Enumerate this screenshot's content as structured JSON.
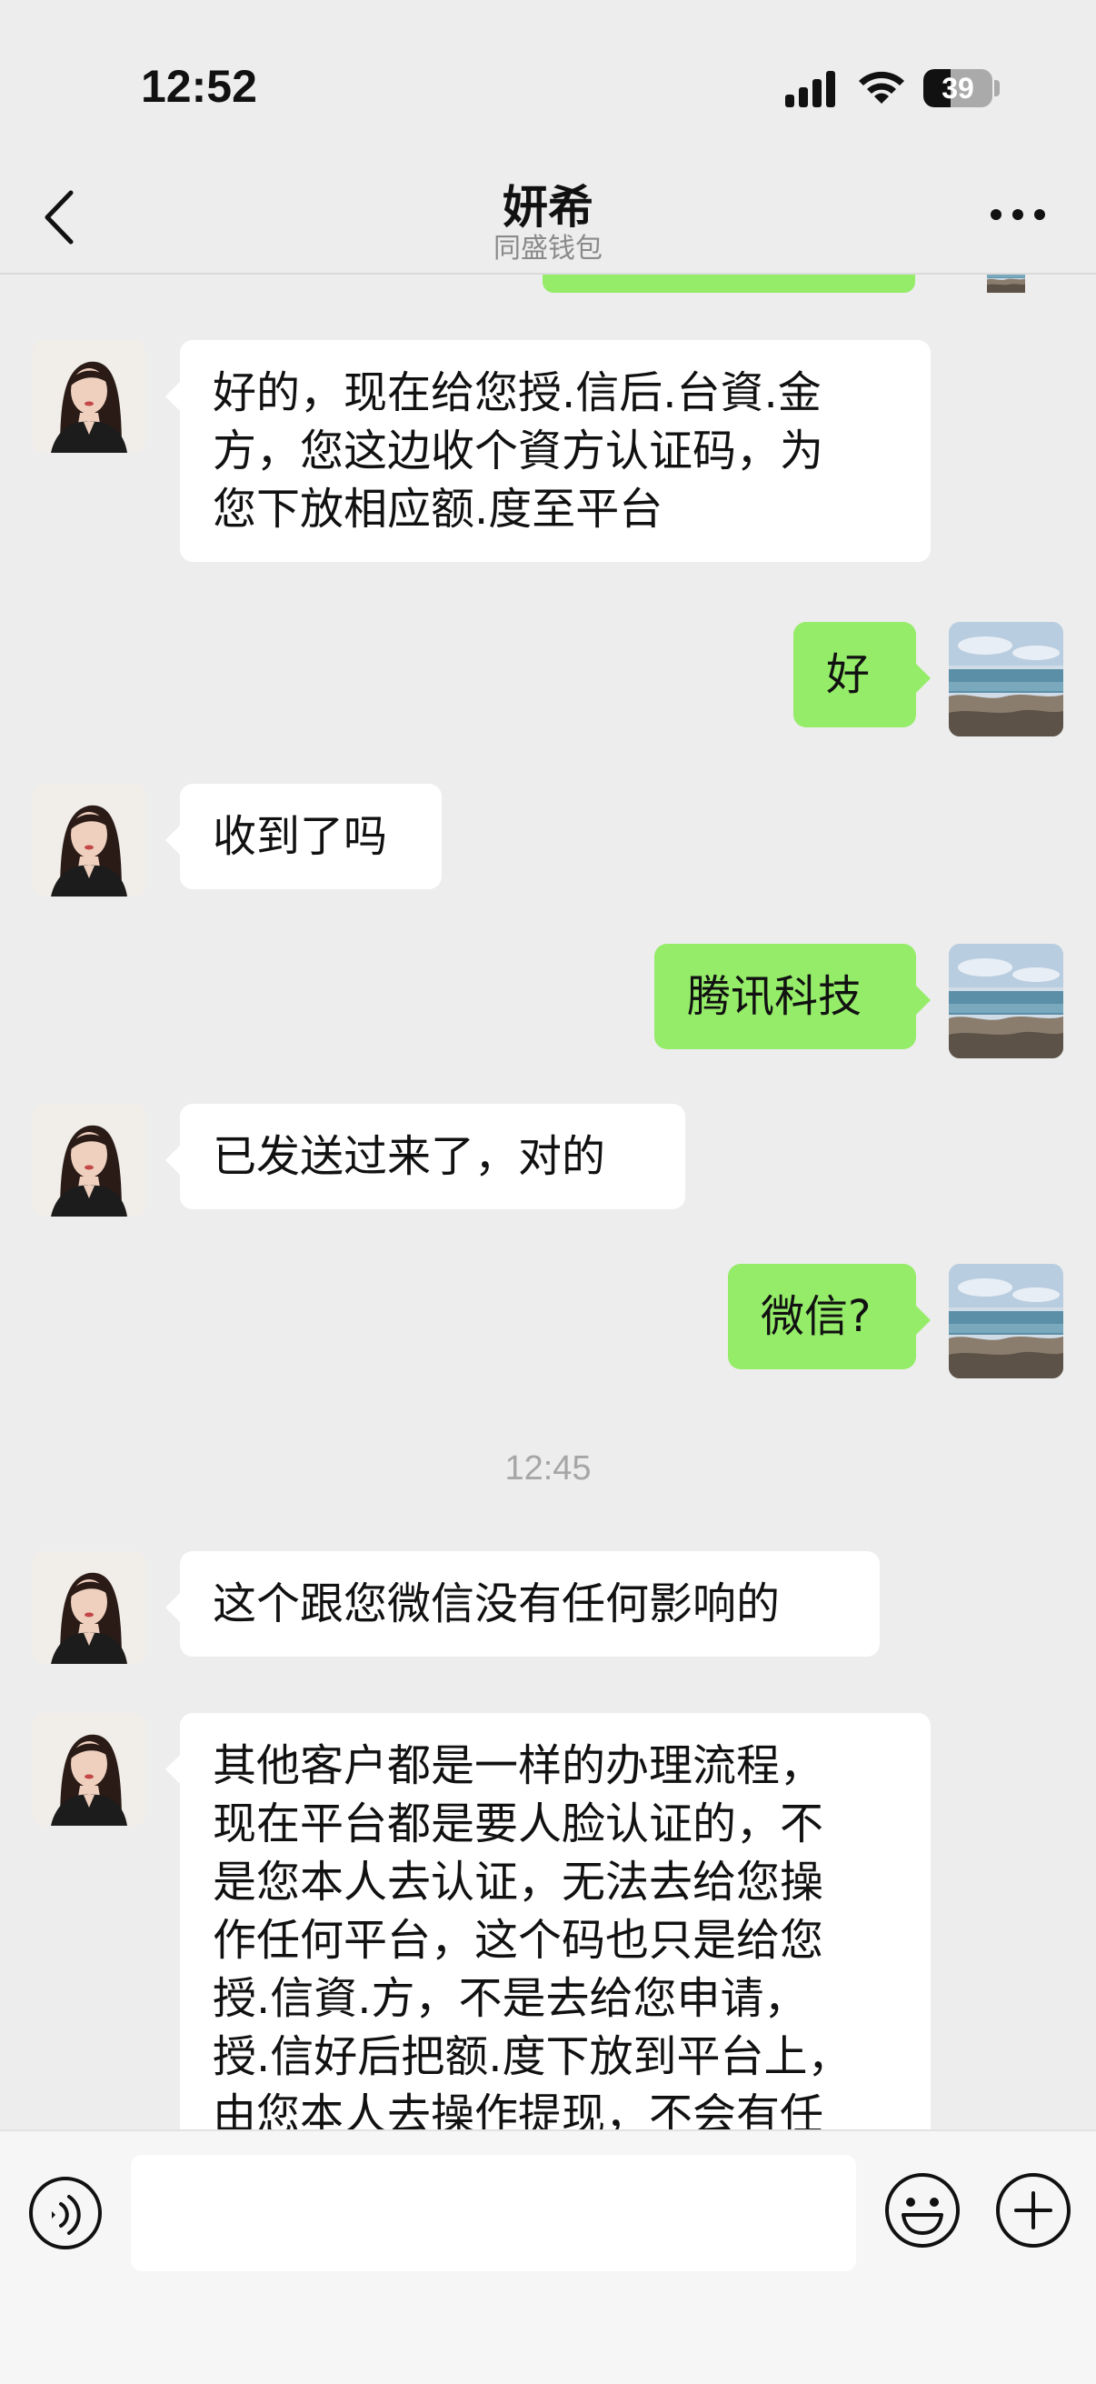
{
  "status_bar": {
    "time": "12:52",
    "battery": "39",
    "battery_level_percent": 39
  },
  "nav": {
    "title": "妍希",
    "subtitle": "同盛钱包",
    "back_icon": "chevron-left-icon",
    "more_icon": "more-dots-icon"
  },
  "messages": [
    {
      "side": "in",
      "text": "好的，现在给您授.信后.台資.金\n方，您这边收个資方认证码，为\n您下放相应额.度至平台"
    },
    {
      "side": "out",
      "text": "好"
    },
    {
      "side": "in",
      "text": "收到了吗"
    },
    {
      "side": "out",
      "text": "腾讯科技"
    },
    {
      "side": "in",
      "text": "已发送过来了，对的"
    },
    {
      "side": "out",
      "text": "微信?"
    },
    {
      "side": "in",
      "text": "这个跟您微信没有任何影响的"
    },
    {
      "side": "in",
      "text": "其他客户都是一样的办理流程，\n现在平台都是要人脸认证的，不\n是您本人去认证，无法去给您操\n作任何平台，这个码也只是给您\n授.信資.方，不是去给您申请，\n授.信好后把额.度下放到平台上，\n由您本人去操作提现，不会有任"
    }
  ],
  "timestamp": "12:45",
  "input_bar": {
    "placeholder": "",
    "icons": [
      "voice-icon",
      "emoji-icon",
      "plus-icon"
    ]
  },
  "colors": {
    "background": "#ededed",
    "outgoing_bubble": "#95ec69",
    "incoming_bubble": "#ffffff",
    "timestamp": "#a6a6a6"
  }
}
